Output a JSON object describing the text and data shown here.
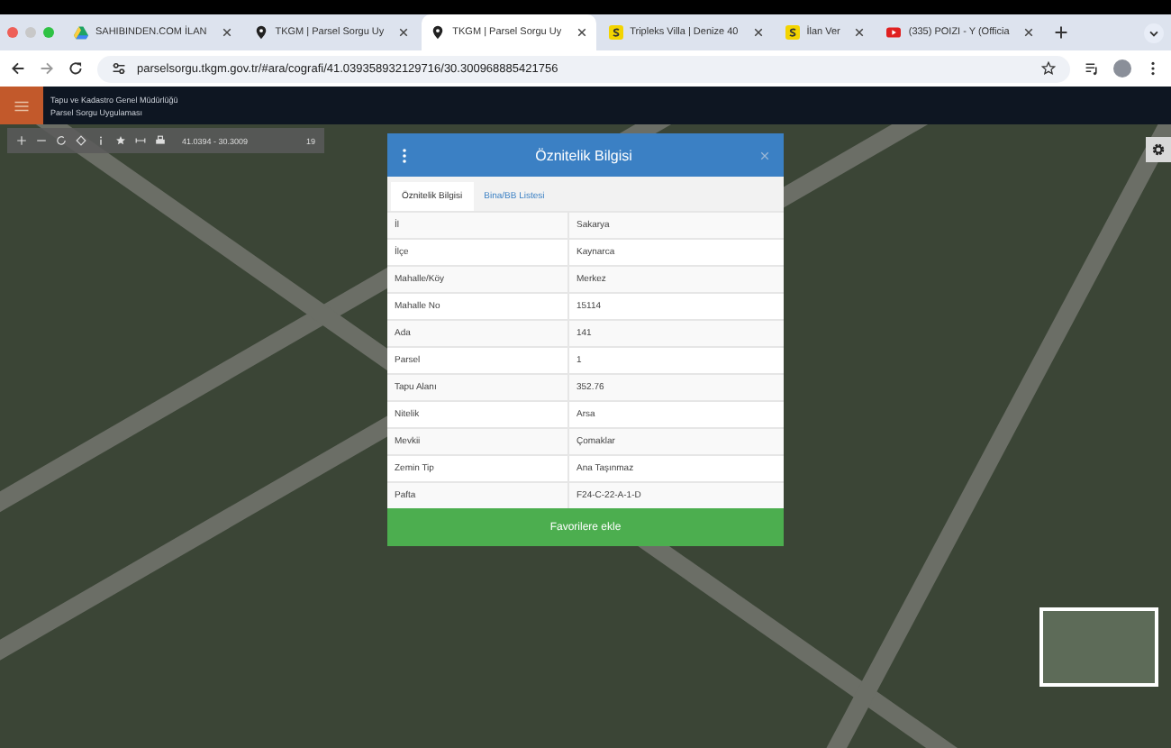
{
  "browser": {
    "tabs": [
      {
        "title": "SAHIBINDEN.COM İLAN",
        "selected": false,
        "kind": "drive"
      },
      {
        "title": "TKGM | Parsel Sorgu Uy",
        "selected": false,
        "kind": "pin"
      },
      {
        "title": "TKGM | Parsel Sorgu Uy",
        "selected": true,
        "kind": "pin"
      },
      {
        "title": "Tripleks Villa | Denize 40",
        "selected": false,
        "kind": "s"
      },
      {
        "title": "İlan Ver",
        "selected": false,
        "kind": "s"
      },
      {
        "title": "(335) POIZI - Y (Officia",
        "selected": false,
        "kind": "video"
      }
    ],
    "address": "parselsorgu.tkgm.gov.tr/#ara/cografi/41.039358932129716/30.300968885421756"
  },
  "header": {
    "org": "Tapu ve Kadastro Genel Müdürlüğü",
    "app": "Parsel Sorgu Uygulaması"
  },
  "toolbar": {
    "coordinates": "41.0394 - 30.3009",
    "zoom": "19"
  },
  "dialog": {
    "title": "Öznitelik Bilgisi",
    "tabs": [
      {
        "label": "Öznitelik Bilgisi",
        "selected": true
      },
      {
        "label": "Bina/BB Listesi",
        "selected": false
      }
    ],
    "rows": [
      {
        "label": "İl",
        "value": "Sakarya"
      },
      {
        "label": "İlçe",
        "value": "Kaynarca"
      },
      {
        "label": "Mahalle/Köy",
        "value": "Merkez"
      },
      {
        "label": "Mahalle No",
        "value": "15114"
      },
      {
        "label": "Ada",
        "value": "141"
      },
      {
        "label": "Parsel",
        "value": "1"
      },
      {
        "label": "Tapu Alanı",
        "value": "352.76"
      },
      {
        "label": "Nitelik",
        "value": "Arsa"
      },
      {
        "label": "Mevkii",
        "value": "Çomaklar"
      },
      {
        "label": "Zemin Tip",
        "value": "Ana Taşınmaz"
      },
      {
        "label": "Pafta",
        "value": "F24-C-22-A-1-D"
      }
    ],
    "button": "Favorilere ekle"
  }
}
